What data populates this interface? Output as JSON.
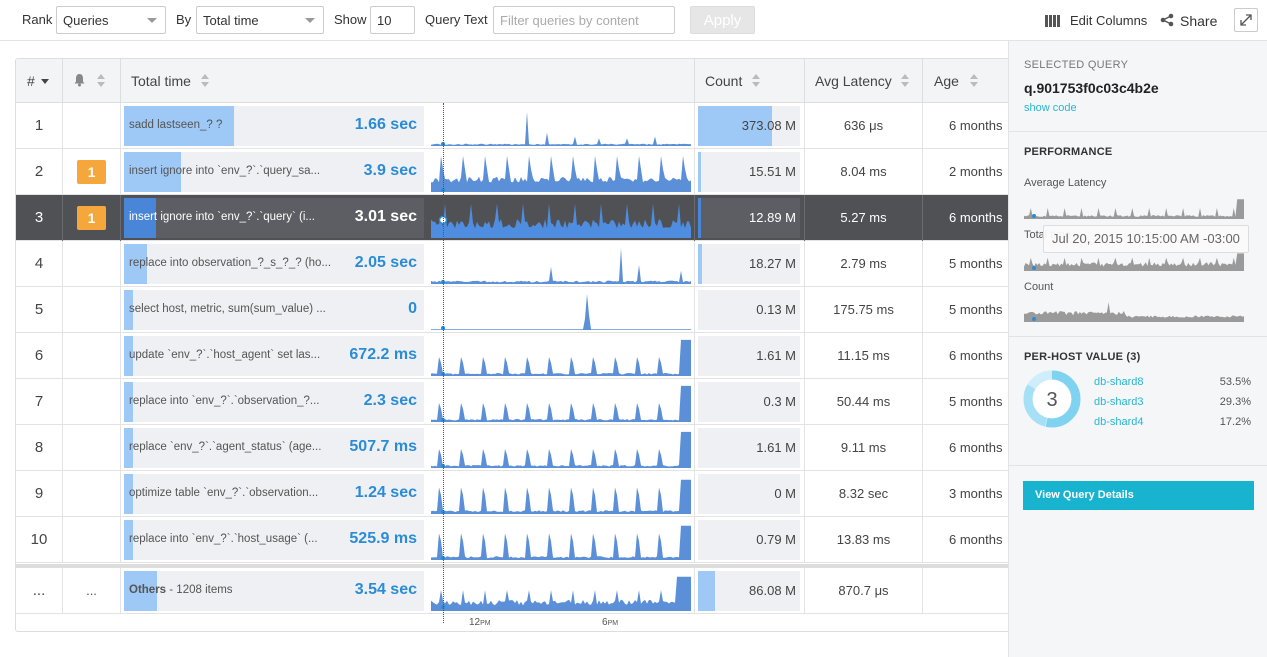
{
  "toolbar": {
    "rank_label": "Rank",
    "rank_value": "Queries",
    "by_label": "By",
    "by_value": "Total time",
    "show_label": "Show",
    "show_value": "10",
    "query_text_label": "Query Text",
    "query_placeholder": "Filter queries by content",
    "apply_label": "Apply",
    "edit_columns_label": "Edit Columns",
    "share_label": "Share"
  },
  "table": {
    "headers": {
      "num": "#",
      "total_time": "Total time",
      "count": "Count",
      "avg_latency": "Avg Latency",
      "age": "Age"
    },
    "rows": [
      {
        "num": "1",
        "badge": "",
        "query": "sadd lastseen_? ?",
        "total": "1.66 sec",
        "time_frac": 0.365,
        "count": "373.08 M",
        "count_frac": 0.73,
        "latency": "636 μs",
        "age": "6 months",
        "spark": "spike1"
      },
      {
        "num": "2",
        "badge": "1",
        "query": "insert ignore into `env_?`.`query_sa...",
        "total": "3.9 sec",
        "time_frac": 0.19,
        "count": "15.51 M",
        "count_frac": 0.03,
        "latency": "8.04 ms",
        "age": "2 months",
        "spark": "periodic"
      },
      {
        "num": "3",
        "badge": "1",
        "query": "insert ignore into `env_?`.`query` (i...",
        "total": "3.01 sec",
        "time_frac": 0.105,
        "count": "12.89 M",
        "count_frac": 0.025,
        "latency": "5.27 ms",
        "age": "6 months",
        "spark": "dense"
      },
      {
        "num": "4",
        "badge": "",
        "query": "replace into observation_?_s_?_? (ho...",
        "total": "2.05 sec",
        "time_frac": 0.075,
        "count": "18.27 M",
        "count_frac": 0.035,
        "latency": "2.79 ms",
        "age": "5 months",
        "spark": "sparse"
      },
      {
        "num": "5",
        "badge": "",
        "query": "select host, metric, sum(sum_value) ...",
        "total": "0",
        "time_frac": 0.03,
        "count": "0.13 M",
        "count_frac": 0.0,
        "latency": "175.75 ms",
        "age": "5 months",
        "spark": "spike2"
      },
      {
        "num": "6",
        "badge": "",
        "query": "update `env_?`.`host_agent` set las...",
        "total": "672.2 ms",
        "time_frac": 0.03,
        "count": "1.61 M",
        "count_frac": 0.0,
        "latency": "11.15 ms",
        "age": "6 months",
        "spark": "periodic2"
      },
      {
        "num": "7",
        "badge": "",
        "query": "replace into `env_?`.`observation_?...",
        "total": "2.3 sec",
        "time_frac": 0.03,
        "count": "0.3 M",
        "count_frac": 0.0,
        "latency": "50.44 ms",
        "age": "5 months",
        "spark": "periodic2"
      },
      {
        "num": "8",
        "badge": "",
        "query": "replace `env_?`.`agent_status` (age...",
        "total": "507.7 ms",
        "time_frac": 0.03,
        "count": "1.61 M",
        "count_frac": 0.0,
        "latency": "9.11 ms",
        "age": "6 months",
        "spark": "periodic2"
      },
      {
        "num": "9",
        "badge": "",
        "query": "optimize table `env_?`.`observation...",
        "total": "1.24 sec",
        "time_frac": 0.03,
        "count": "0 M",
        "count_frac": 0.0,
        "latency": "8.32 sec",
        "age": "3 months",
        "spark": "periodic3"
      },
      {
        "num": "10",
        "badge": "",
        "query": "replace into `env_?`.`host_usage` (...",
        "total": "525.9 ms",
        "time_frac": 0.03,
        "count": "0.79 M",
        "count_frac": 0.0,
        "latency": "13.83 ms",
        "age": "6 months",
        "spark": "periodic3"
      }
    ],
    "others": {
      "num": "...",
      "badge": "...",
      "query_bold": "Others",
      "query_rest": " - 1208 items",
      "total": "3.54 sec",
      "time_frac": 0.11,
      "count": "86.08 M",
      "count_frac": 0.17,
      "latency": "870.7 μs",
      "age": ""
    },
    "axis_ticks": [
      {
        "hour": "12",
        "suffix": "PM"
      },
      {
        "hour": "6",
        "suffix": "PM"
      }
    ]
  },
  "panel": {
    "selected_label": "SELECTED QUERY",
    "query_id": "q.901753f0c03c4b2e",
    "show_code": "show code",
    "performance_label": "PERFORMANCE",
    "avg_latency_label": "Average Latency",
    "total_label": "Total time",
    "count_label": "Count",
    "tooltip": "Jul 20, 2015 10:15:00 AM -03:00",
    "per_host_label": "PER-HOST VALUE (3)",
    "host_count": "3",
    "hosts": [
      {
        "name": "db-shard8",
        "pct": "53.5%",
        "frac": 0.535
      },
      {
        "name": "db-shard3",
        "pct": "29.3%",
        "frac": 0.293
      },
      {
        "name": "db-shard4",
        "pct": "17.2%",
        "frac": 0.172
      }
    ],
    "view_details": "View Query Details"
  },
  "colors": {
    "accent": "#2b8cd6",
    "bar_fill": "#9ec8f5",
    "spark": "#5b8fd8",
    "badge": "#f5a73b",
    "selected_row": "#505155",
    "cta": "#17b3cf"
  }
}
